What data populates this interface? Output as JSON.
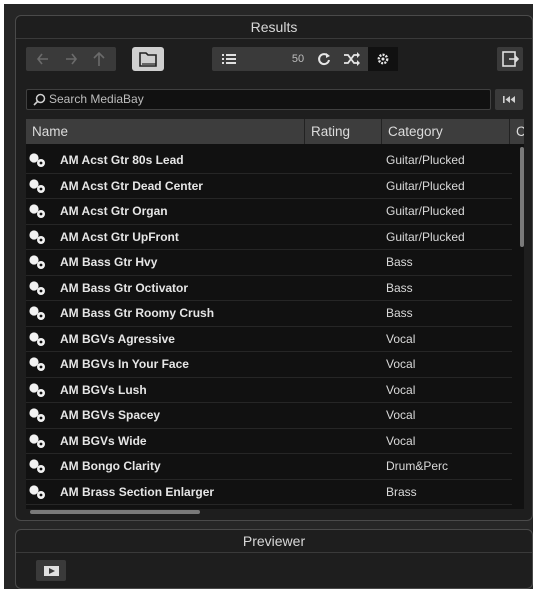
{
  "results_panel": {
    "title": "Results",
    "results_count": "50",
    "search": {
      "placeholder": "Search MediaBay"
    },
    "columns": [
      "Name",
      "Rating",
      "Category",
      "C"
    ],
    "rows": [
      {
        "name": "AM Acst Gtr 80s Lead",
        "category": "Guitar/Plucked"
      },
      {
        "name": "AM Acst Gtr Dead Center",
        "category": "Guitar/Plucked"
      },
      {
        "name": "AM Acst Gtr Organ",
        "category": "Guitar/Plucked"
      },
      {
        "name": "AM Acst Gtr UpFront",
        "category": "Guitar/Plucked"
      },
      {
        "name": "AM Bass Gtr Hvy",
        "category": "Bass"
      },
      {
        "name": "AM Bass Gtr Octivator",
        "category": "Bass"
      },
      {
        "name": "AM Bass Gtr Roomy Crush",
        "category": "Bass"
      },
      {
        "name": "AM BGVs Agressive",
        "category": "Vocal"
      },
      {
        "name": "AM BGVs In Your Face",
        "category": "Vocal"
      },
      {
        "name": "AM BGVs Lush",
        "category": "Vocal"
      },
      {
        "name": "AM BGVs Spacey",
        "category": "Vocal"
      },
      {
        "name": "AM BGVs Wide",
        "category": "Vocal"
      },
      {
        "name": "AM Bongo Clarity",
        "category": "Drum&Perc"
      },
      {
        "name": "AM Brass Section Enlarger",
        "category": "Brass"
      }
    ]
  },
  "previewer_panel": {
    "title": "Previewer"
  },
  "icons": {
    "back": "arrow-left-icon",
    "forward": "arrow-right-icon",
    "up": "arrow-up-icon",
    "browse": "folder-icon",
    "list": "list-icon",
    "refresh": "refresh-icon",
    "shuffle": "shuffle-icon",
    "settings": "gear-icon",
    "export": "export-icon",
    "search": "search-icon",
    "search_end": "skip-back-icon",
    "preset": "preset-icon",
    "preview": "play-preview-icon"
  },
  "colors": {
    "panel_bg": "#1e1e1e",
    "grid_bg": "#111111",
    "header_bg": "#3d3d3d",
    "text": "#e6e6e6"
  }
}
